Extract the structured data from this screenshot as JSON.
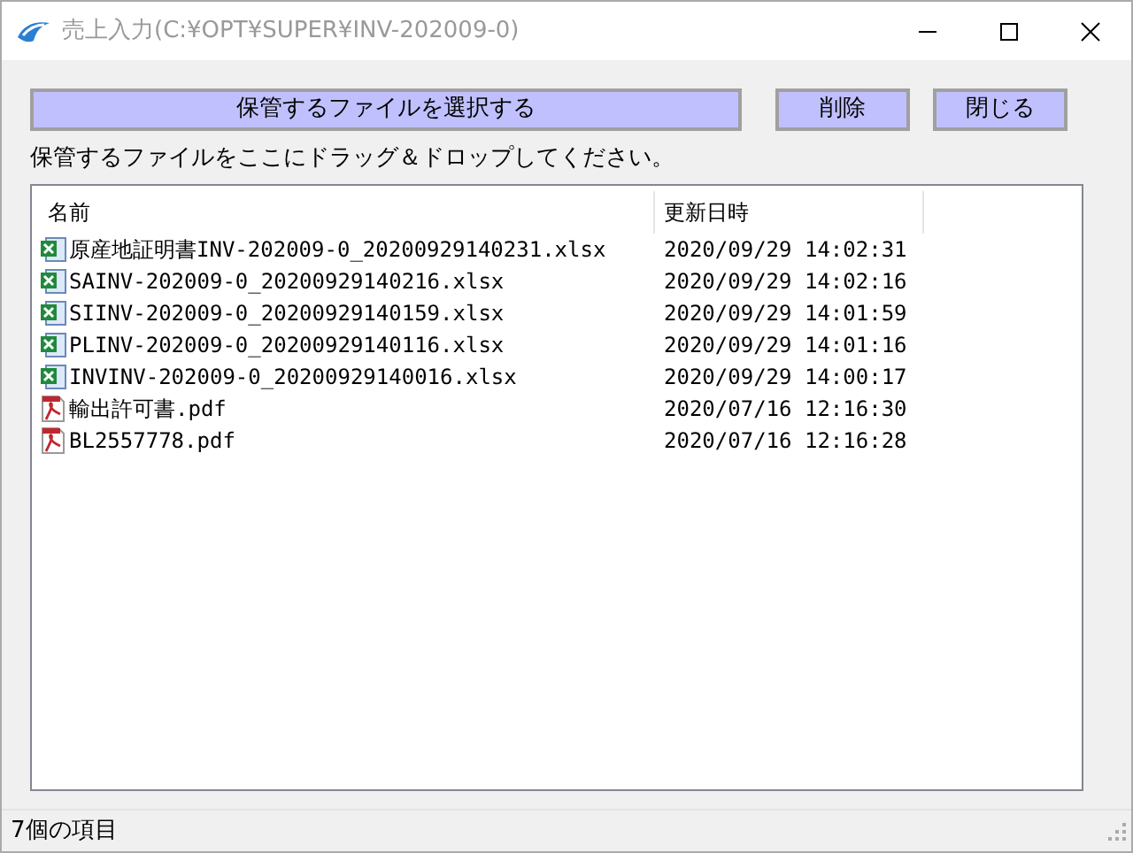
{
  "window": {
    "title": "売上入力(C:¥OPT¥SUPER¥INV-202009-0)"
  },
  "buttons": [
    {
      "label": "保管するファイルを選択する",
      "kind": "wide"
    },
    {
      "label": "削除",
      "kind": "small"
    },
    {
      "label": "閉じる",
      "kind": "small"
    }
  ],
  "hint": "保管するファイルをここにドラッグ＆ドロップしてください。",
  "table": {
    "columns": [
      "名前",
      "更新日時"
    ],
    "rows": [
      {
        "kind": "excel",
        "name": "原産地証明書INV-202009-0_20200929140231.xlsx",
        "modified": "2020/09/29 14:02:31"
      },
      {
        "kind": "excel",
        "name": "SAINV-202009-0_20200929140216.xlsx",
        "modified": "2020/09/29 14:02:16"
      },
      {
        "kind": "excel",
        "name": "SIINV-202009-0_20200929140159.xlsx",
        "modified": "2020/09/29 14:01:59"
      },
      {
        "kind": "excel",
        "name": "PLINV-202009-0_20200929140116.xlsx",
        "modified": "2020/09/29 14:01:16"
      },
      {
        "kind": "excel",
        "name": "INVINV-202009-0_20200929140016.xlsx",
        "modified": "2020/09/29 14:00:17"
      },
      {
        "kind": "pdf",
        "name": "輸出許可書.pdf",
        "modified": "2020/07/16 12:16:30"
      },
      {
        "kind": "pdf",
        "name": "BL2557778.pdf",
        "modified": "2020/07/16 12:16:28"
      }
    ]
  },
  "status_bar": "7個の項目"
}
